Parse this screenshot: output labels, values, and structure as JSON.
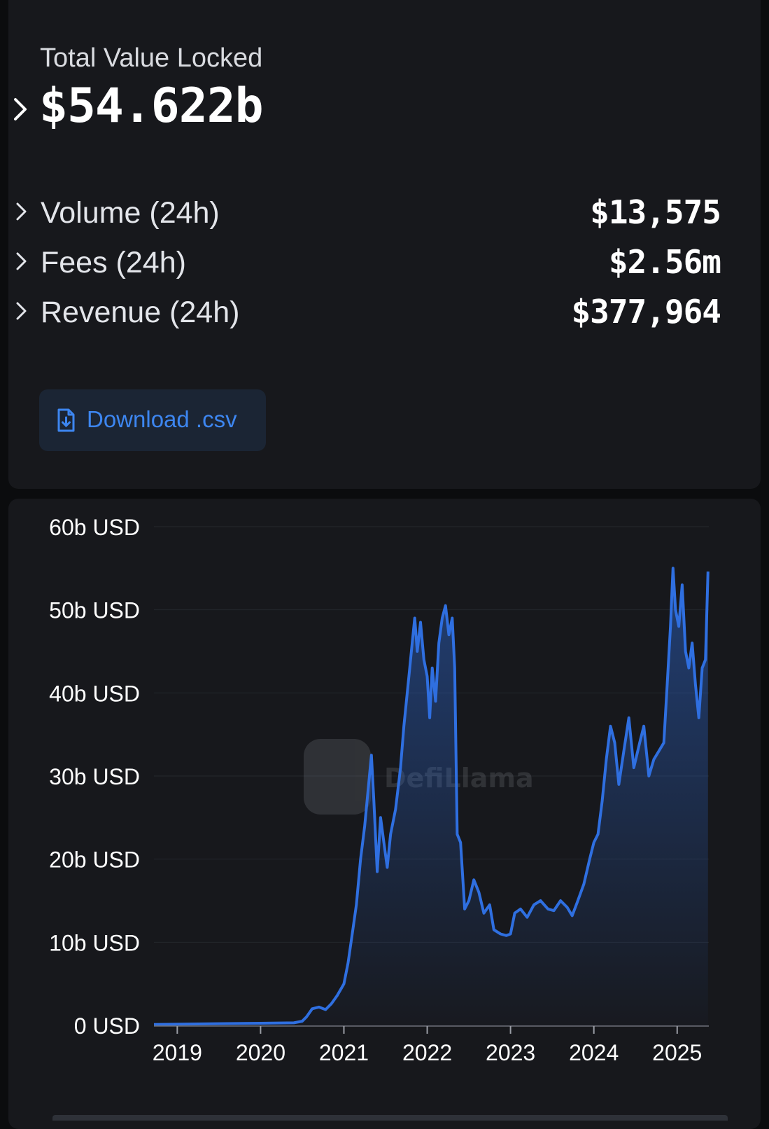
{
  "summary": {
    "tvl_label": "Total Value Locked",
    "tvl_value": "$54.622b",
    "metrics": [
      {
        "label": "Volume (24h)",
        "value": "$13,575"
      },
      {
        "label": "Fees (24h)",
        "value": "$2.56m"
      },
      {
        "label": "Revenue (24h)",
        "value": "$377,964"
      }
    ],
    "download_label": "Download .csv"
  },
  "colors": {
    "accent": "#2f6fe0",
    "card": "#17181c",
    "background": "#0b0c0e"
  },
  "chart_data": {
    "type": "area",
    "y_unit": "b USD",
    "ylim": [
      0,
      60
    ],
    "yticks": [
      0,
      10,
      20,
      30,
      40,
      50,
      60
    ],
    "ytick_labels": [
      "0 USD",
      "10b USD",
      "20b USD",
      "30b USD",
      "40b USD",
      "50b USD",
      "60b USD"
    ],
    "xlim": [
      2018.72,
      2025.38
    ],
    "xticks": [
      2019,
      2020,
      2021,
      2022,
      2023,
      2024,
      2025
    ],
    "xtick_labels": [
      "2019",
      "2020",
      "2021",
      "2022",
      "2023",
      "2024",
      "2025"
    ],
    "grid": true,
    "watermark": "DefiLlama",
    "series": [
      {
        "points": [
          [
            2018.72,
            0.1
          ],
          [
            2019.5,
            0.2
          ],
          [
            2020.0,
            0.25
          ],
          [
            2020.4,
            0.3
          ],
          [
            2020.5,
            0.5
          ],
          [
            2020.55,
            1.0
          ],
          [
            2020.62,
            2.0
          ],
          [
            2020.7,
            2.2
          ],
          [
            2020.78,
            1.9
          ],
          [
            2020.85,
            2.6
          ],
          [
            2020.92,
            3.6
          ],
          [
            2021.0,
            5.0
          ],
          [
            2021.05,
            7.5
          ],
          [
            2021.1,
            11.0
          ],
          [
            2021.15,
            14.5
          ],
          [
            2021.2,
            20.0
          ],
          [
            2021.25,
            24.0
          ],
          [
            2021.33,
            32.5
          ],
          [
            2021.36,
            27.0
          ],
          [
            2021.4,
            18.5
          ],
          [
            2021.44,
            25.0
          ],
          [
            2021.48,
            22.0
          ],
          [
            2021.52,
            19.0
          ],
          [
            2021.56,
            23.0
          ],
          [
            2021.62,
            26.0
          ],
          [
            2021.68,
            31.0
          ],
          [
            2021.72,
            36.0
          ],
          [
            2021.78,
            42.0
          ],
          [
            2021.82,
            46.0
          ],
          [
            2021.85,
            49.0
          ],
          [
            2021.88,
            45.0
          ],
          [
            2021.92,
            48.5
          ],
          [
            2021.96,
            44.0
          ],
          [
            2022.0,
            42.0
          ],
          [
            2022.03,
            37.0
          ],
          [
            2022.06,
            43.0
          ],
          [
            2022.1,
            39.0
          ],
          [
            2022.14,
            46.0
          ],
          [
            2022.18,
            49.0
          ],
          [
            2022.22,
            50.5
          ],
          [
            2022.26,
            47.0
          ],
          [
            2022.3,
            49.0
          ],
          [
            2022.33,
            43.0
          ],
          [
            2022.36,
            23.0
          ],
          [
            2022.4,
            22.0
          ],
          [
            2022.45,
            14.0
          ],
          [
            2022.5,
            15.0
          ],
          [
            2022.56,
            17.5
          ],
          [
            2022.62,
            16.0
          ],
          [
            2022.68,
            13.5
          ],
          [
            2022.75,
            14.5
          ],
          [
            2022.8,
            11.5
          ],
          [
            2022.88,
            11.0
          ],
          [
            2022.95,
            10.8
          ],
          [
            2023.0,
            11.0
          ],
          [
            2023.05,
            13.5
          ],
          [
            2023.12,
            14.0
          ],
          [
            2023.2,
            13.0
          ],
          [
            2023.28,
            14.5
          ],
          [
            2023.36,
            15.0
          ],
          [
            2023.45,
            14.0
          ],
          [
            2023.52,
            13.8
          ],
          [
            2023.6,
            15.0
          ],
          [
            2023.68,
            14.2
          ],
          [
            2023.74,
            13.2
          ],
          [
            2023.8,
            14.8
          ],
          [
            2023.88,
            17.0
          ],
          [
            2023.95,
            20.0
          ],
          [
            2024.0,
            22.0
          ],
          [
            2024.05,
            23.0
          ],
          [
            2024.1,
            27.0
          ],
          [
            2024.15,
            32.0
          ],
          [
            2024.2,
            36.0
          ],
          [
            2024.25,
            34.0
          ],
          [
            2024.3,
            29.0
          ],
          [
            2024.36,
            33.0
          ],
          [
            2024.42,
            37.0
          ],
          [
            2024.48,
            31.0
          ],
          [
            2024.55,
            34.0
          ],
          [
            2024.6,
            36.0
          ],
          [
            2024.66,
            30.0
          ],
          [
            2024.72,
            32.0
          ],
          [
            2024.78,
            33.0
          ],
          [
            2024.84,
            34.0
          ],
          [
            2024.88,
            41.0
          ],
          [
            2024.92,
            48.0
          ],
          [
            2024.95,
            55.0
          ],
          [
            2024.98,
            50.0
          ],
          [
            2025.02,
            48.0
          ],
          [
            2025.06,
            53.0
          ],
          [
            2025.1,
            45.0
          ],
          [
            2025.14,
            43.0
          ],
          [
            2025.18,
            46.0
          ],
          [
            2025.22,
            41.0
          ],
          [
            2025.26,
            37.0
          ],
          [
            2025.3,
            43.0
          ],
          [
            2025.34,
            44.0
          ],
          [
            2025.37,
            54.6
          ]
        ]
      }
    ]
  }
}
